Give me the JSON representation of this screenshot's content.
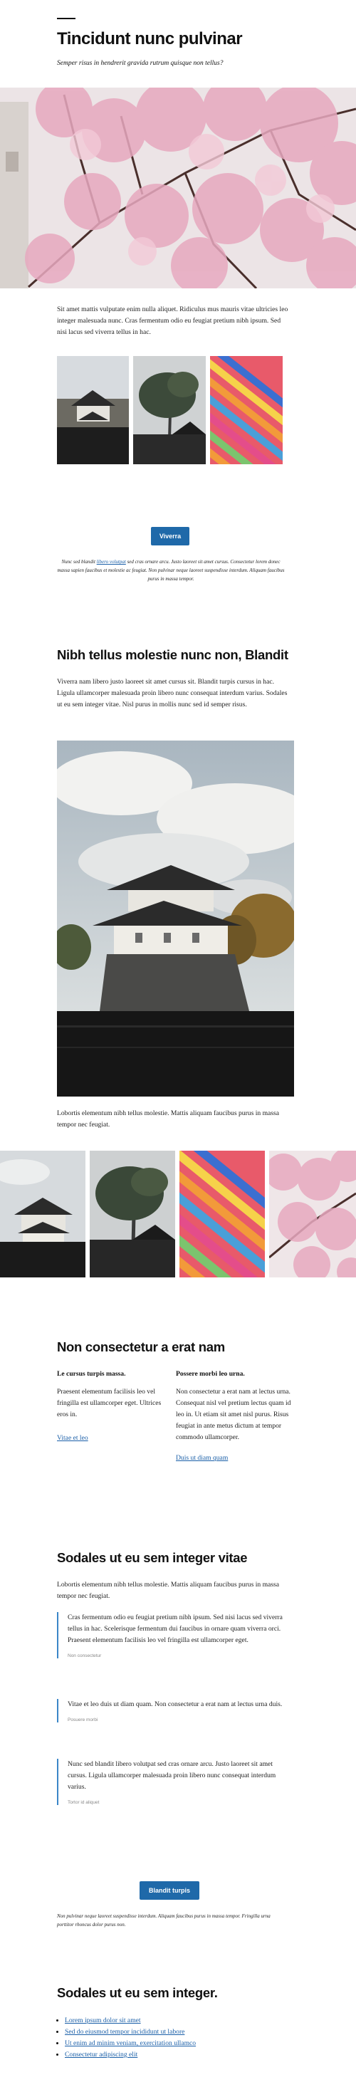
{
  "header": {
    "title": "Tincidunt nunc pulvinar",
    "subtitle": "Semper risus in hendrerit gravida rutrum quisque non tellus?"
  },
  "intro": {
    "paragraph": "Sit amet mattis vulputate enim nulla aliquet. Ridiculus mus mauris vitae ultricies leo integer malesuada nunc. Cras fermentum odio eu feugiat pretium nibh ipsum. Sed nisi lacus sed viverra tellus in hac."
  },
  "gallery1": {
    "button_label": "Viverra",
    "caption_before": "Nunc sed blandit ",
    "caption_link": "libero volutpat",
    "caption_after": " sed cras ornare arcu. Justo laoreet sit amet cursus. Consectetur lorem donec massa sapien faucibus et molestie ac feugiat. Non pulvinar neque laoreet suspendisse interdum. Aliquam faucibus purus in massa tempor."
  },
  "section2": {
    "heading": "Nibh tellus molestie nunc non, Blandit",
    "paragraph": "Viverra nam libero justo laoreet sit amet cursus sit. Blandit turpis cursus in hac. Ligula ullamcorper malesuada proin libero nunc consequat interdum varius. Sodales ut eu sem integer vitae. Nisl purus in mollis nunc sed id semper risus.",
    "paragraph2": "Lobortis elementum nibh tellus molestie. Mattis aliquam faucibus purus in massa tempor nec feugiat."
  },
  "section3": {
    "heading": "Non consectetur a erat nam",
    "col1": {
      "heading": "Le cursus turpis massa.",
      "text": "Praesent elementum facilisis leo vel fringilla est ullamcorper eget. Ultrices eros in.",
      "link": "Vitae et leo"
    },
    "col2": {
      "heading": "Possere morbi leo urna.",
      "text": "Non consectetur a erat nam at lectus urna. Consequat nisl vel pretium lectus quam id leo in. Ut etiam sit amet nisl purus. Risus feugiat in ante metus dictum at tempor commodo ullamcorper.",
      "link": "Duis ut diam quam"
    }
  },
  "section4": {
    "heading": "Sodales ut eu sem integer vitae",
    "paragraph": "Lobortis elementum nibh tellus molestie. Mattis aliquam faucibus purus in massa tempor nec feugiat.",
    "quotes": [
      {
        "text": "Cras fermentum odio eu feugiat pretium nibh ipsum. Sed nisi lacus sed viverra tellus in hac. Scelerisque fermentum dui faucibus in ornare quam viverra orci. Praesent elementum facilisis leo vel fringilla est ullamcorper eget.",
        "cite": "Non consectetur"
      },
      {
        "text": "Vitae et leo duis ut diam quam. Non consectetur a erat nam at lectus urna duis.",
        "cite": "Posuere morbi"
      },
      {
        "text": "Nunc sed blandit libero volutpat sed cras ornare arcu. Justo laoreet sit amet cursus. Ligula ullamcorper malesuada proin libero nunc consequat interdum varius.",
        "cite": "Tortor id aliquet"
      }
    ],
    "button_label": "Blandit turpis",
    "caption": "Non pulvinar neque laoreet suspendisse interdum. Aliquam faucibus purus in massa tempor. Fringilla urna porttitor rhoncus dolor purus non."
  },
  "section5": {
    "heading": "Sodales ut eu sem integer.",
    "links": [
      "Lorem ipsum dolor sit amet",
      "Sed do eiusmod tempor incididunt ut labore",
      "Ut enim ad minim veniam, exercitation ullamco",
      "Consectetur adipiscing elit"
    ]
  },
  "colors": {
    "accent": "#1f69a9",
    "link": "#1a5fa8",
    "quote_border": "#3a86c8"
  }
}
